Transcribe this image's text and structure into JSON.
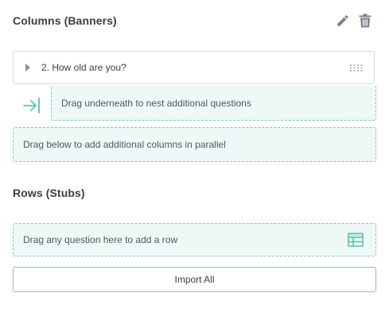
{
  "columns": {
    "title": "Columns (Banners)",
    "question": {
      "label": "2. How old are you?"
    },
    "nest_dropzone_text": "Drag underneath to nest additional questions",
    "parallel_dropzone_text": "Drag below to add additional columns in parallel"
  },
  "rows": {
    "title": "Rows (Stubs)",
    "dropzone_text": "Drag any question here to add a row"
  },
  "actions": {
    "import_all_label": "Import All"
  },
  "colors": {
    "accent_teal": "#5fbfad",
    "dropzone_fill": "#eef8f6",
    "icon_gray": "#7c828b"
  },
  "icons": {
    "edit": "pencil-icon",
    "delete": "trash-icon",
    "expand": "caret-right-icon",
    "drag": "grip-dots-icon",
    "nest": "nest-arrow-icon",
    "table": "table-icon"
  }
}
